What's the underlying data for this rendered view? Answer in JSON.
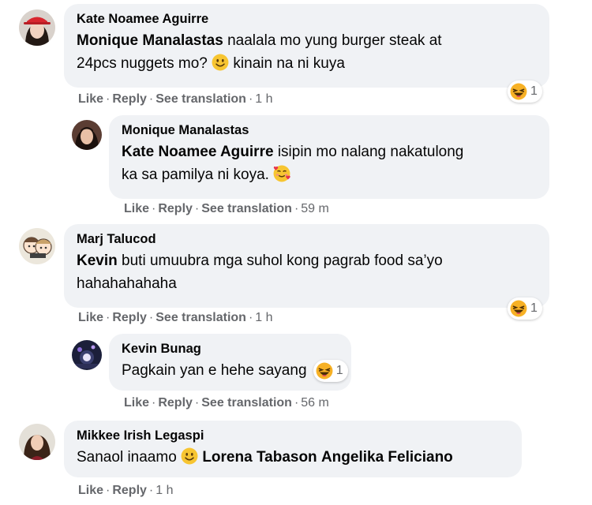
{
  "actions": {
    "like": "Like",
    "reply": "Reply",
    "translate": "See translation",
    "dot": "·"
  },
  "comments": [
    {
      "author": "Kate Noamee Aguirre",
      "mention": "Monique Manalastas",
      "text_a": "naalala mo yung burger steak at",
      "text_b": "24pcs nuggets mo?",
      "text_c": "kinain na ni kuya",
      "time": "1 h",
      "reaction_count": "1"
    },
    {
      "author": "Monique Manalastas",
      "mention": "Kate Noamee Aguirre",
      "text_a": "isipin mo nalang nakatulong",
      "text_b": "ka sa pamilya ni koya.",
      "time": "59 m"
    },
    {
      "author": "Marj Talucod",
      "mention": "Kevin",
      "text_a": "buti umuubra mga suhol kong pagrab food sa’yo",
      "text_b": "hahahahahaha",
      "time": "1 h",
      "reaction_count": "1"
    },
    {
      "author": "Kevin Bunag",
      "text": "Pagkain yan e hehe sayang",
      "time": "56 m",
      "reaction_count": "1"
    },
    {
      "author": "Mikkee Irish Legaspi",
      "text": "Sanaol inaamo",
      "mention_a": "Lorena Tabason",
      "mention_b": "Angelika Feliciano",
      "time": "1 h"
    }
  ],
  "colors": {
    "bubble": "#f0f2f5",
    "meta": "#65676b",
    "text": "#050505"
  }
}
